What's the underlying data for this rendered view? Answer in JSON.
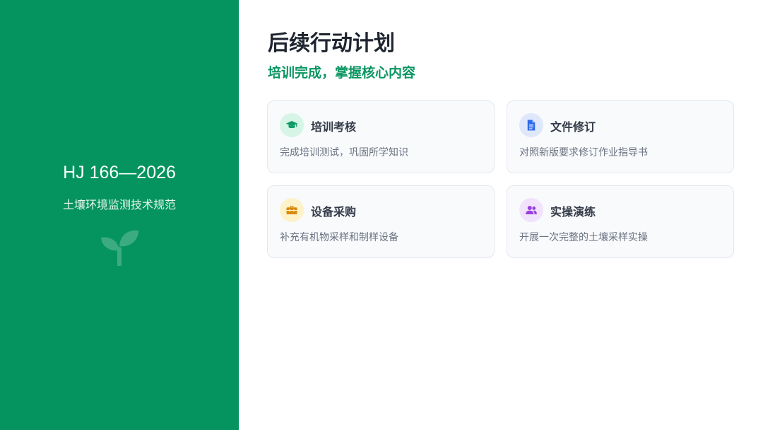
{
  "sidebar": {
    "title": "HJ 166—2026",
    "subtitle": "土壤环境监测技术规范",
    "logo_icon": "sprout-icon"
  },
  "main": {
    "title": "后续行动计划",
    "subtitle": "培训完成，掌握核心内容",
    "cards": [
      {
        "title": "培训考核",
        "desc": "完成培训测试，巩固所学知识",
        "icon": "graduation-cap-icon",
        "icon_color": "#0f9a67",
        "icon_bg": "#d6f5e6"
      },
      {
        "title": "文件修订",
        "desc": "对照新版要求修订作业指导书",
        "icon": "document-icon",
        "icon_color": "#2f6bea",
        "icon_bg": "#dfe8fb"
      },
      {
        "title": "设备采购",
        "desc": "补充有机物采样和制样设备",
        "icon": "toolbox-icon",
        "icon_color": "#d98a0b",
        "icon_bg": "#fdf2c9"
      },
      {
        "title": "实操演练",
        "desc": "开展一次完整的土壤采样实操",
        "icon": "users-icon",
        "icon_color": "#9a3fe0",
        "icon_bg": "#f1e3fb"
      }
    ]
  },
  "colors": {
    "brand_green": "#05945f",
    "subtitle_green": "#0b9662",
    "heading": "#1f2530"
  }
}
